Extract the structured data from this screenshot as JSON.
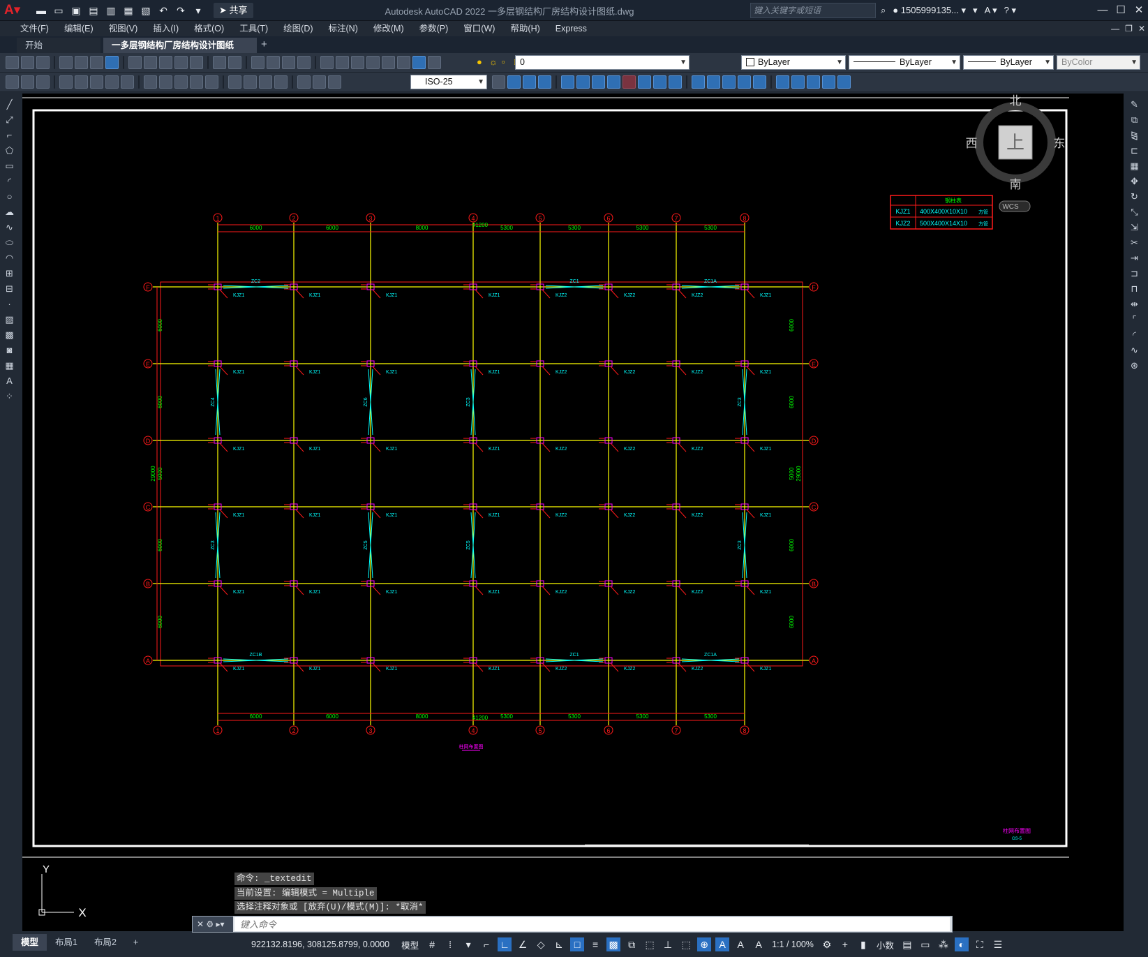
{
  "app": {
    "logo": "A",
    "title": "Autodesk AutoCAD 2022    一多层钢结构厂房结构设计图纸.dwg",
    "share_label": "共享",
    "search_placeholder": "键入关键字或短语",
    "user": "1505999135...",
    "help": "?"
  },
  "menu": [
    "文件(F)",
    "编辑(E)",
    "视图(V)",
    "插入(I)",
    "格式(O)",
    "工具(T)",
    "绘图(D)",
    "标注(N)",
    "修改(M)",
    "参数(P)",
    "窗口(W)",
    "帮助(H)",
    "Express"
  ],
  "tabs": {
    "start": "开始",
    "active": "一多层钢结构厂房结构设计图纸*",
    "close": "×",
    "add": "+"
  },
  "toolbar": {
    "layer": "0",
    "color": "ByLayer",
    "linetype": "ByLayer",
    "lineweight": "ByLayer",
    "plotstyle": "ByColor",
    "dimstyle": "ISO-25"
  },
  "viewcube": {
    "north": "北",
    "south": "南",
    "east": "东",
    "west": "西",
    "top": "上",
    "wcs": "WCS"
  },
  "drawing": {
    "col_axes": [
      "1",
      "2",
      "3",
      "4",
      "5",
      "6",
      "7",
      "8"
    ],
    "row_axes": [
      "F",
      "E",
      "D",
      "C",
      "B",
      "A"
    ],
    "col_spacings": [
      "6000",
      "6000",
      "8000",
      "5300",
      "5300",
      "5300",
      "5300"
    ],
    "total_width": "41200",
    "row_spacings": [
      "6000",
      "6000",
      "5000",
      "6000",
      "6000"
    ],
    "total_height": "29000",
    "legend": {
      "header": "钢柱表",
      "rows": [
        {
          "id": "KJZ1",
          "size": "400X400X10X10",
          "note": "方管"
        },
        {
          "id": "KJZ2",
          "size": "500X400X14X10",
          "note": "方管"
        }
      ]
    },
    "drawing_title": "柱网布置图",
    "titleblock_name": "柱网布置图",
    "titleblock_no": "GS-5",
    "brace_top": [
      "ZC2",
      "ZC1",
      "ZC1A"
    ],
    "brace_bottom": [
      "ZC1B",
      "ZC1",
      "ZC1A"
    ],
    "brace_vert_upper": [
      "ZC4",
      "ZC6",
      "ZC3",
      "ZC3"
    ],
    "brace_vert_lower": [
      "ZC3",
      "ZC5",
      "ZC5",
      "ZC3"
    ],
    "col_type_by_axis": [
      "KJZ1",
      "KJZ1",
      "KJZ1",
      "KJZ1",
      "KJZ2",
      "KJZ2",
      "KJZ2",
      "KJZ1"
    ],
    "ucs_x": "X",
    "ucs_y": "Y"
  },
  "command": {
    "history": [
      "命令:  _textedit",
      "当前设置: 编辑模式 = Multiple",
      "选择注释对象或 [放弃(U)/模式(M)]: *取消*"
    ],
    "placeholder": "键入命令"
  },
  "status": {
    "layouts": [
      "模型",
      "布局1",
      "布局2",
      "+"
    ],
    "coords": "922132.8196, 308125.8799, 0.0000",
    "model": "模型",
    "scale": "1:1 / 100%",
    "units": "小数"
  }
}
